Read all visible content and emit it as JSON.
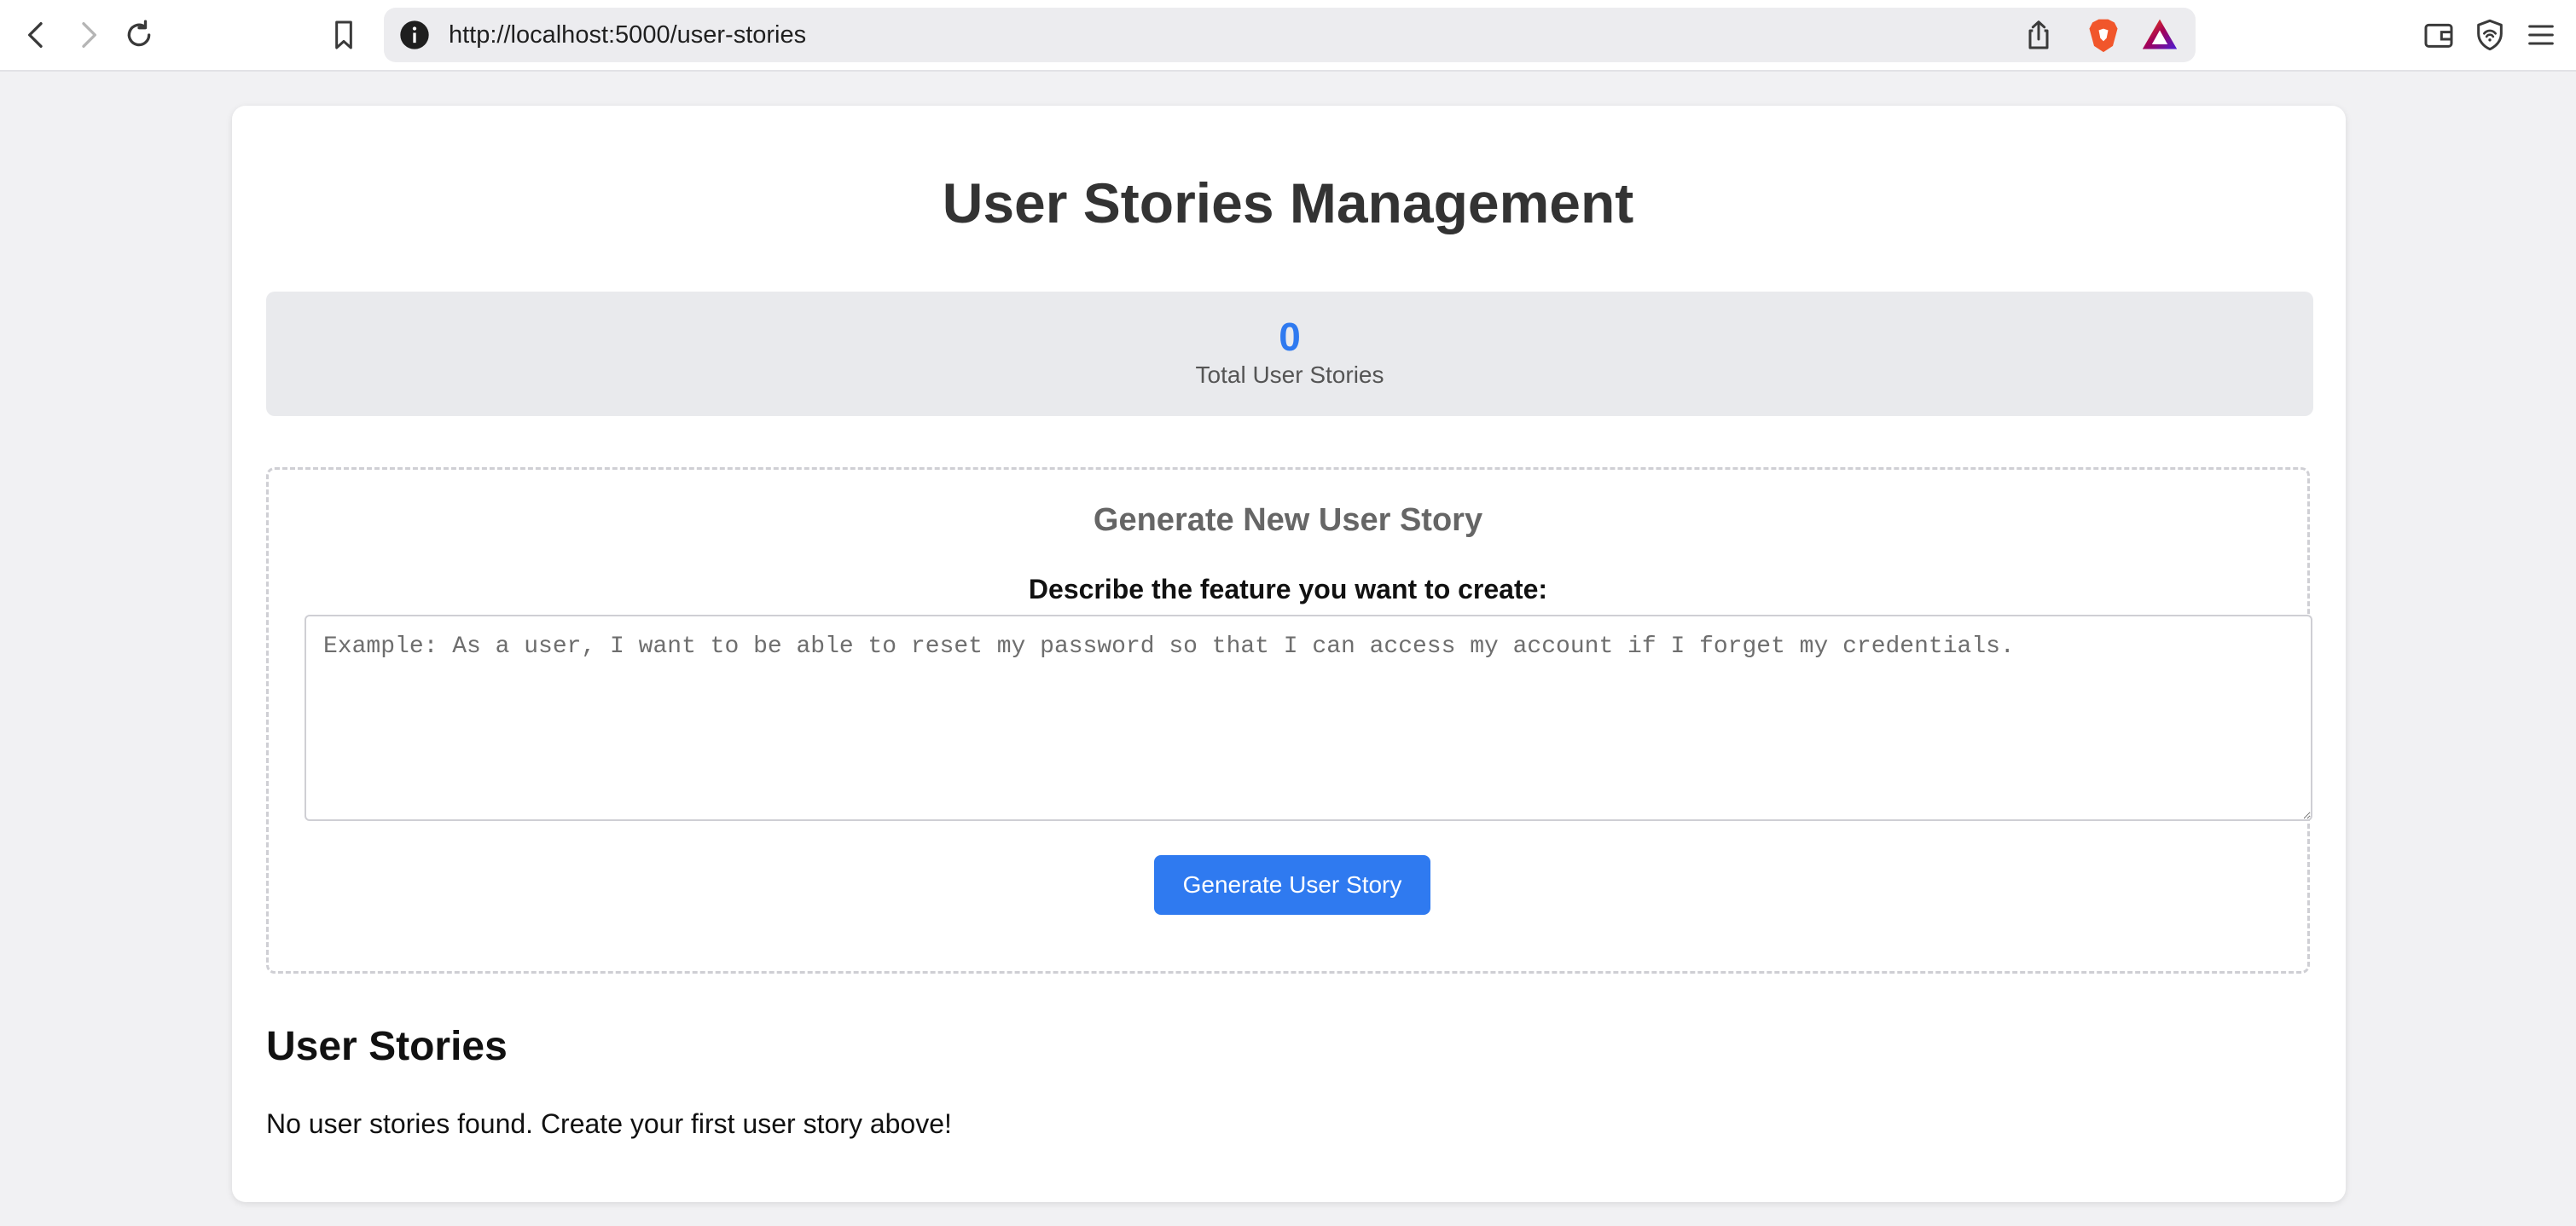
{
  "browser": {
    "url": "http://localhost:5000/user-stories"
  },
  "page": {
    "title": "User Stories Management",
    "stats": {
      "total_count": "0",
      "total_label": "Total User Stories"
    },
    "generator": {
      "title": "Generate New User Story",
      "input_label": "Describe the feature you want to create:",
      "input_value": "",
      "input_placeholder": "Example: As a user, I want to be able to reset my password so that I can access my account if I forget my credentials.",
      "button_label": "Generate User Story"
    },
    "list": {
      "heading": "User Stories",
      "empty_message": "No user stories found. Create your first user story above!"
    }
  },
  "colors": {
    "accent": "#2f7af0",
    "page_bg": "#f1f1f3",
    "stats_bg": "#e9eaed"
  }
}
